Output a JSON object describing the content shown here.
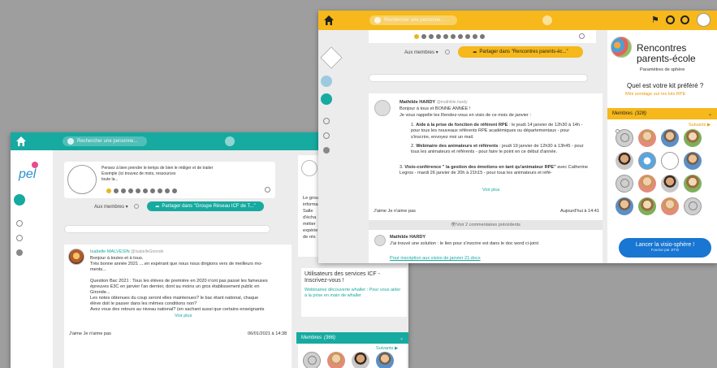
{
  "left_window": {
    "accent": "#16aaa1",
    "search_placeholder": "Rechercher une personne...",
    "composer": {
      "placeholder_lines": [
        "Pensez à bien prendre le temps de bien le rédiger et de traiter",
        "Exemple (ici trouvez de mots, ressources",
        "toute la..."
      ],
      "members_label": "Aux membres ▾",
      "share_button": "Partager dans \"Groupe Réseau ICF de T...\""
    },
    "post": {
      "author": "Isabelle MALVESIN",
      "handle": "@IsabelleGironde",
      "lines": [
        "Bonjour à toutes et à tous.",
        "Très bonne année 2021 ....en espérant que nous nous dirigions vers de meilleurs mo-",
        "ments...",
        "",
        "Question Bac 2021 : Tous les élèves de première en 2020 n'ont pas passé les fameuses",
        "épreuves E3C en janvier l'an dernier, dont au moins un gros établissement public en",
        "Gironde...",
        "Les notes obtenues du coup seront elles maintenues? le bac étant national, chaque",
        "élève doit le passer dans les mêmes conditions non?",
        "Avez vous des retours au niveau national? (en sachant aussi que certains enseignants"
      ],
      "see_more": "Voir plus",
      "footer": "J'aime   Je n'aime pas",
      "date": "06/01/2021 à 14:38"
    },
    "right_panel": {
      "text_lines": [
        "Le grou",
        "informa",
        "Salle",
        "d'écha",
        "métier",
        "expérie",
        "de rés"
      ],
      "promo_title": "Utilisateurs des services ICF - Inscrivez-vous !",
      "promo_body": "Webinaires découverte whaller : Pour vous aider à la prise en main de whaller",
      "members_label": "Membres",
      "members_count": "(366)",
      "follow": "Suivants ▶"
    }
  },
  "right_window": {
    "accent": "#f6b81a",
    "search_placeholder": "Rechercher une personne...",
    "composer": {
      "members_label": "Aux membres ▾",
      "share_button": "Partager dans \"Rencontres parents-éc...\""
    },
    "post": {
      "author": "Mathilde HARDY",
      "handle": "@mathilde.hardy",
      "greeting": "Bonjour à tous et BONNE ANNÉE !",
      "intro": "Je vous rappelle les Rendez-vous en visio de ce mois de janvier :",
      "items": [
        {
          "title": "Aide à la prise de fonction de référent RPE",
          "text": " : le jeudi 14 janvier de 12h30 à 14h - pour tous les nouveaux référents RPE académiques ou départementaux - pour s'inscrire, envoyez moi un mail."
        },
        {
          "title": "Webinaire des animateurs et référents",
          "text": " : jeudi 19 janvier de 12h30 à 13h45 - pour tous les animateurs et référents - pour faire le point en ce début d'année."
        },
        {
          "title": "Visio-conférence \" la gestion des émotions en tant qu'animateur RPE\"",
          "text": " avec Catherine Legros - mardi 26 janvier de 20h à 21h15 - pour tous les animateurs et réfé-"
        }
      ],
      "see_more": "Voir plus",
      "footer": "J'aime   Je n'aime pas",
      "date": "Aujourd'hui à 14:41",
      "comments_link": "Voir 2 commentaires précédents"
    },
    "reply": {
      "author": "Mathilde HARDY",
      "text": "J'ai trouvé une solution : le lien pour s'inscrire est dans le doc word ci-joint",
      "attachment": "Pour inscription aux visios de janvier 21.docx"
    },
    "group": {
      "title": "Rencontres parents-école",
      "params": "Paramètres de sphère",
      "poll_question": "Quel est votre kit préféré ?",
      "poll_link": "Mini sondage sur les kits RPE",
      "members_label": "Membres",
      "members_count": "(328)",
      "follow": "Suivants ▶",
      "visio_button": "Lancer la visio-sphère !",
      "visio_sub": "Fournie par JITSI"
    }
  }
}
